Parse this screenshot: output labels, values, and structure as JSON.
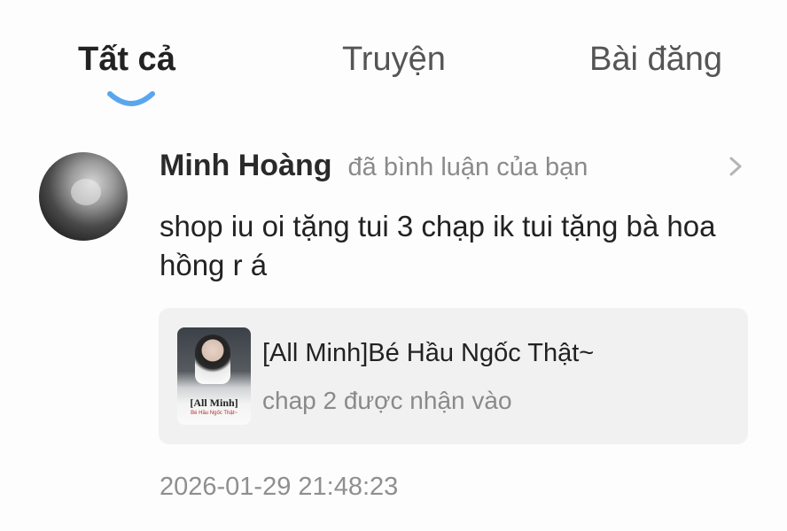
{
  "tabs": {
    "all": "Tất cả",
    "stories": "Truyện",
    "posts": "Bài đăng",
    "active": "all",
    "indicator_color": "#5aa6ee"
  },
  "notification": {
    "user_name": "Minh Hoàng",
    "action": "đã bình luận của bạn",
    "comment": "shop iu oi tặng tui 3 chạp ik tui tặng bà hoa hồng r á",
    "story": {
      "title": "[All Minh]Bé Hầu Ngốc Thật~",
      "subtitle": "chap 2 được nhận vào",
      "cover_title": "[All Minh]",
      "cover_subtitle": "Bé Hầu Ngốc Thật~"
    },
    "timestamp": "2026-01-29 21:48:23",
    "icons": {
      "chevron": "chevron-right-icon",
      "avatar": "user-avatar"
    }
  }
}
